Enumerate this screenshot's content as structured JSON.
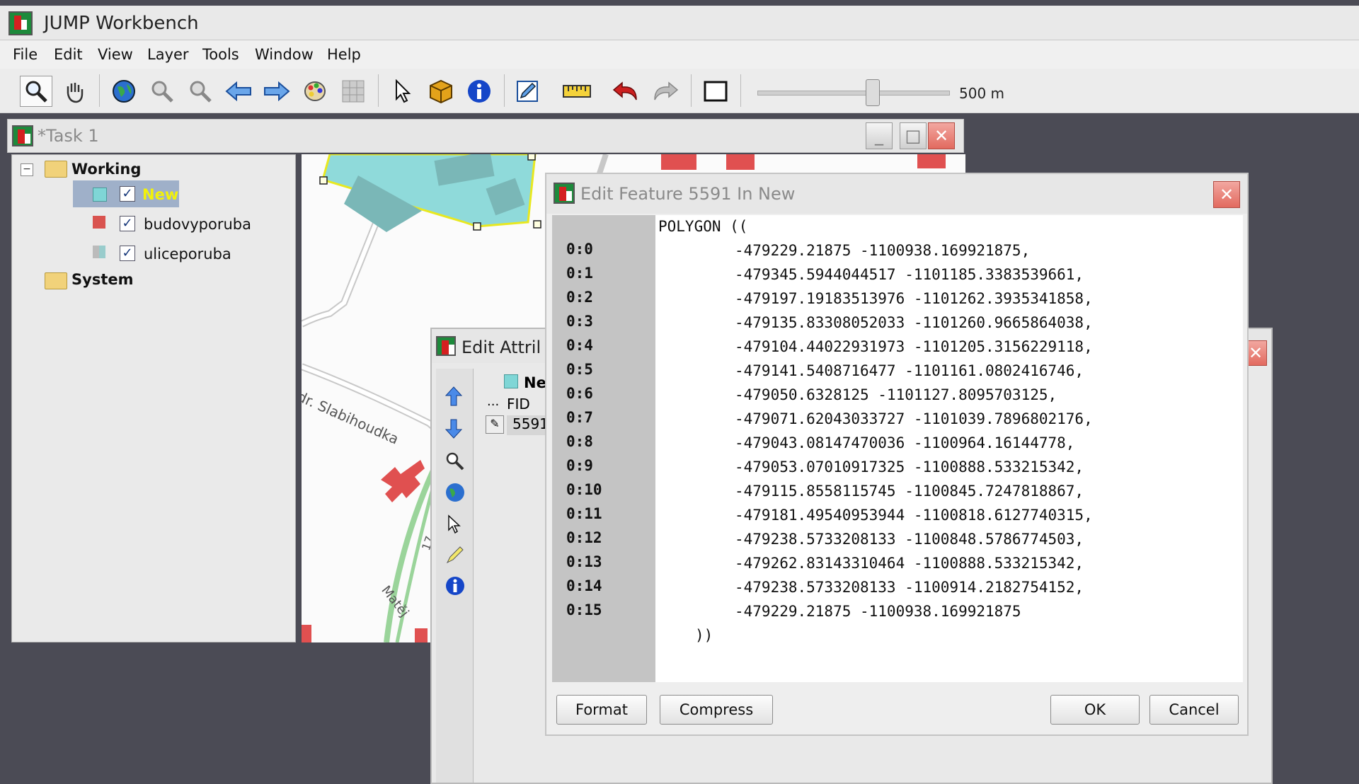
{
  "app": {
    "title": "JUMP Workbench"
  },
  "menu": [
    "File",
    "Edit",
    "View",
    "Layer",
    "Tools",
    "Window",
    "Help"
  ],
  "toolbar": {
    "icons": [
      "zoom-icon",
      "pan-icon",
      "zoom-full-icon",
      "zoom-layer-icon",
      "zoom-selected-icon",
      "zoom-previous-icon",
      "zoom-next-icon",
      "layer-style-icon",
      "grid-icon",
      "select-icon",
      "feature-info-icon",
      "info-icon",
      "edit-icon",
      "measure-icon",
      "undo-icon",
      "redo-icon",
      "window-icon"
    ],
    "scale_label": "500 m",
    "scale_slider_fraction": 0.6
  },
  "task": {
    "title": "*Task 1"
  },
  "layers": {
    "working_label": "Working",
    "system_label": "System",
    "items": [
      {
        "name": "New",
        "color": "#7fd6d6",
        "checked": true
      },
      {
        "name": "budovyporuba",
        "color": "#d9534f",
        "checked": true
      },
      {
        "name": "uliceporuba",
        "color": "#8aa",
        "checked": true
      }
    ]
  },
  "map": {
    "street_labels": [
      "dr. Slabihoudka",
      "Matěj",
      "17"
    ]
  },
  "attributes": {
    "title": "Edit Attril",
    "layer_label": "Ne",
    "column": "FID",
    "ellipsis": "...",
    "row_value": "5591"
  },
  "dialog": {
    "title": "Edit Feature 5591 In New",
    "header": "POLYGON ((",
    "footer": "))",
    "points": [
      {
        "label": "0:0",
        "text": "-479229.21875 -1100938.169921875,"
      },
      {
        "label": "0:1",
        "text": "-479345.5944044517 -1101185.3383539661,"
      },
      {
        "label": "0:2",
        "text": "-479197.19183513976 -1101262.3935341858,"
      },
      {
        "label": "0:3",
        "text": "-479135.83308052033 -1101260.9665864038,"
      },
      {
        "label": "0:4",
        "text": "-479104.44022931973 -1101205.3156229118,"
      },
      {
        "label": "0:5",
        "text": "-479141.5408716477 -1101161.0802416746,"
      },
      {
        "label": "0:6",
        "text": "-479050.6328125 -1101127.8095703125,"
      },
      {
        "label": "0:7",
        "text": "-479071.62043033727 -1101039.7896802176,"
      },
      {
        "label": "0:8",
        "text": "-479043.08147470036 -1100964.16144778,"
      },
      {
        "label": "0:9",
        "text": "-479053.07010917325 -1100888.533215342,"
      },
      {
        "label": "0:10",
        "text": "-479115.8558115745 -1100845.7247818867,"
      },
      {
        "label": "0:11",
        "text": "-479181.49540953944 -1100818.6127740315,"
      },
      {
        "label": "0:12",
        "text": "-479238.5733208133 -1100848.5786774503,"
      },
      {
        "label": "0:13",
        "text": "-479262.83143310464 -1100888.533215342,"
      },
      {
        "label": "0:14",
        "text": "-479238.5733208133 -1100914.2182754152,"
      },
      {
        "label": "0:15",
        "text": "-479229.21875 -1100938.169921875"
      }
    ],
    "buttons": {
      "format": "Format",
      "compress": "Compress",
      "ok": "OK",
      "cancel": "Cancel"
    }
  }
}
